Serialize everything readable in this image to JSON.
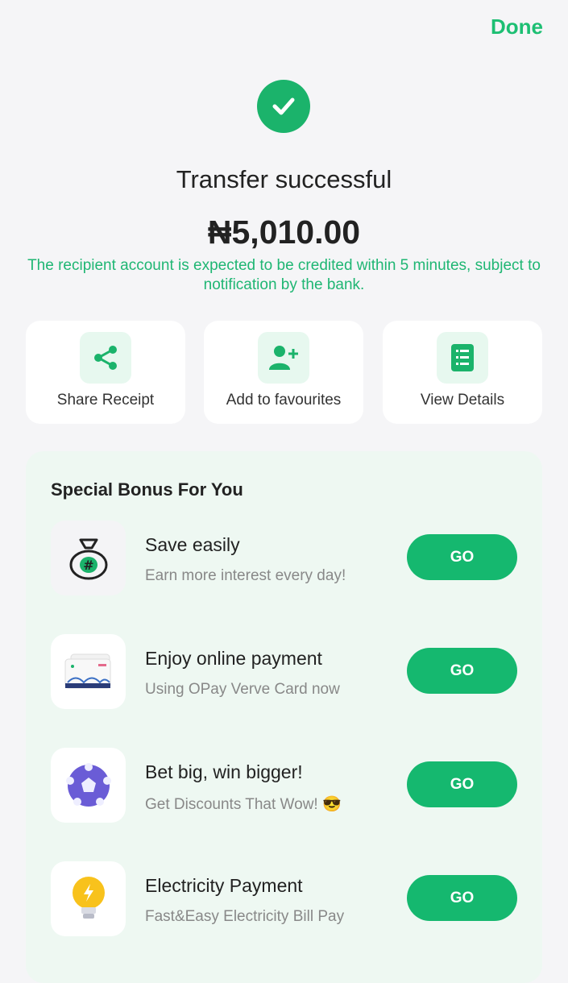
{
  "header": {
    "done_label": "Done"
  },
  "status": {
    "title": "Transfer successful",
    "amount": "₦5,010.00",
    "notice": "The recipient account is expected to be credited within 5 minutes, subject to notification by the bank."
  },
  "actions": [
    {
      "label": "Share Receipt",
      "icon": "share-icon"
    },
    {
      "label": "Add to favourites",
      "icon": "add-user-icon"
    },
    {
      "label": "View Details",
      "icon": "details-list-icon"
    }
  ],
  "bonus": {
    "title": "Special Bonus For You",
    "items": [
      {
        "title": "Save easily",
        "subtitle": "Earn more interest every day!",
        "button": "GO",
        "icon": "money-bag-icon"
      },
      {
        "title": "Enjoy online payment",
        "subtitle": "Using OPay Verve Card now",
        "button": "GO",
        "icon": "verve-card-icon"
      },
      {
        "title": "Bet big, win bigger!",
        "subtitle": "Get Discounts That Wow! 😎",
        "button": "GO",
        "icon": "football-icon"
      },
      {
        "title": "Electricity Payment",
        "subtitle": "Fast&Easy Electricity Bill Pay",
        "button": "GO",
        "icon": "lightbulb-icon"
      }
    ]
  },
  "colors": {
    "accent": "#1bb36b",
    "button": "#15b86f",
    "panel": "#eef8f2"
  }
}
